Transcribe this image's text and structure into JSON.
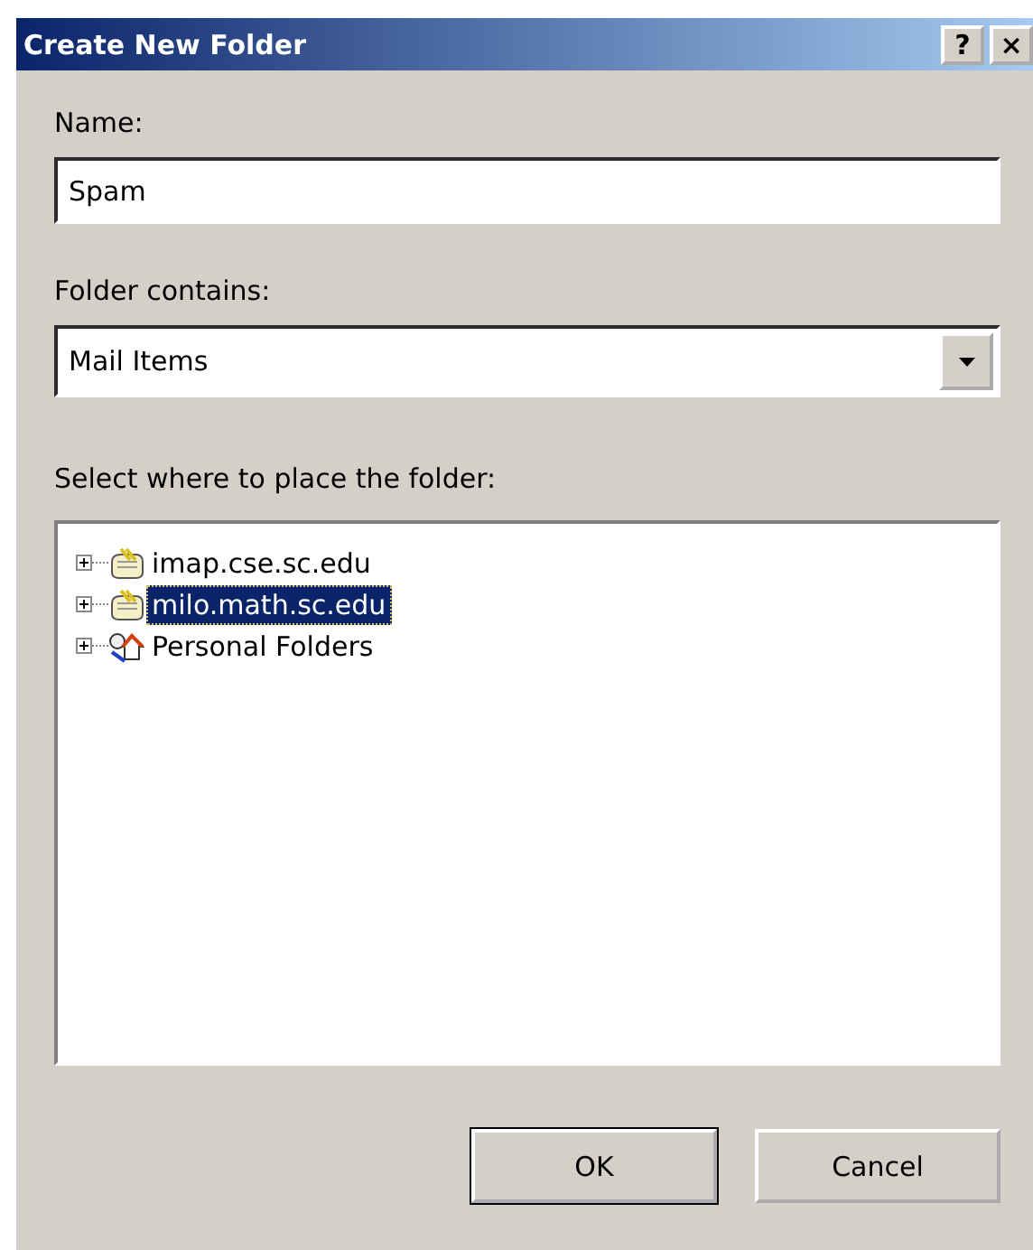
{
  "window": {
    "title": "Create New Folder",
    "buttons": [
      "?",
      "×"
    ]
  },
  "name_field": {
    "label": "Name:",
    "value": "Spam"
  },
  "contains_field": {
    "label": "Folder contains:",
    "value": "Mail Items"
  },
  "location": {
    "label": "Select where to place the folder:",
    "tree": [
      {
        "label": "imap.cse.sc.edu",
        "kind": "server",
        "expanded": false,
        "selected": false
      },
      {
        "label": "milo.math.sc.edu",
        "kind": "server",
        "expanded": false,
        "selected": true
      },
      {
        "label": "Personal Folders",
        "kind": "personal",
        "expanded": false,
        "selected": false
      }
    ]
  },
  "buttons": [
    {
      "label": "OK",
      "default": true
    },
    {
      "label": "Cancel",
      "default": false
    }
  ]
}
